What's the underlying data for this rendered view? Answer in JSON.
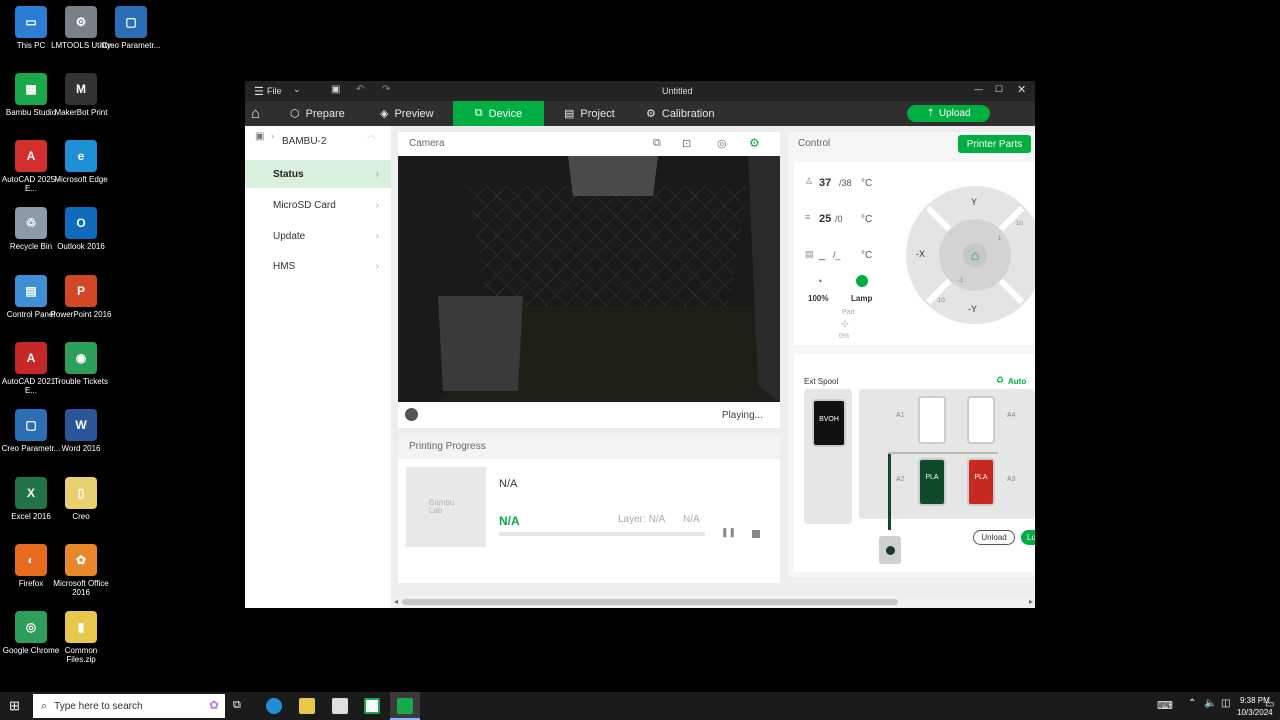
{
  "desktop_icons": [
    {
      "label": "This PC",
      "color": "#2a7fd4",
      "glyph": "▭"
    },
    {
      "label": "LMTOOLS Utility",
      "color": "#7a8088",
      "glyph": "⚙"
    },
    {
      "label": "Creo Parametr...",
      "color": "#2a6fb5",
      "glyph": "▢"
    },
    {
      "label": "Bambu Studio",
      "color": "#19a84a",
      "glyph": "▦"
    },
    {
      "label": "MakerBot Print",
      "color": "#333333",
      "glyph": "M"
    },
    {
      "label": "AutoCAD 2025 - E...",
      "color": "#d32f2f",
      "glyph": "A"
    },
    {
      "label": "Microsoft Edge",
      "color": "#1f8fd6",
      "glyph": "e"
    },
    {
      "label": "Recycle Bin",
      "color": "#8a9aa8",
      "glyph": "♲"
    },
    {
      "label": "Outlook 2016",
      "color": "#0f6cbd",
      "glyph": "O"
    },
    {
      "label": "Control Panel",
      "color": "#3d8fd6",
      "glyph": "▤"
    },
    {
      "label": "PowerPoint 2016",
      "color": "#d24726",
      "glyph": "P"
    },
    {
      "label": "AutoCAD 2021 - E...",
      "color": "#c62828",
      "glyph": "A"
    },
    {
      "label": "Trouble Tickets",
      "color": "#2e9e5b",
      "glyph": "◉"
    },
    {
      "label": "Creo Parametr...",
      "color": "#2a6fb5",
      "glyph": "▢"
    },
    {
      "label": "Word 2016",
      "color": "#2b579a",
      "glyph": "W"
    },
    {
      "label": "Excel 2016",
      "color": "#217346",
      "glyph": "X"
    },
    {
      "label": "Creo",
      "color": "#e8d070",
      "glyph": "▯"
    },
    {
      "label": "Firefox",
      "color": "#e86a1f",
      "glyph": "◐"
    },
    {
      "label": "Microsoft Office 2016",
      "color": "#e8862a",
      "glyph": "✿"
    },
    {
      "label": "Google Chrome",
      "color": "#2e9e5b",
      "glyph": "◎"
    },
    {
      "label": "Common Files.zip",
      "color": "#e8c84a",
      "glyph": "▮"
    }
  ],
  "window": {
    "title": "Untitled",
    "file_menu": "File"
  },
  "tabs": {
    "prepare": "Prepare",
    "preview": "Preview",
    "device": "Device",
    "project": "Project",
    "calibration": "Calibration",
    "upload": "Upload"
  },
  "sidebar": {
    "printer": "BAMBU-2",
    "items": [
      {
        "label": "Status"
      },
      {
        "label": "MicroSD Card"
      },
      {
        "label": "Update"
      },
      {
        "label": "HMS"
      }
    ]
  },
  "camera": {
    "title": "Camera",
    "status": "Playing..."
  },
  "progress": {
    "title": "Printing Progress",
    "name": "N/A",
    "status": "N/A",
    "layer": "Layer: N/A",
    "time": "N/A",
    "logo": "Bambu Lab"
  },
  "control": {
    "title": "Control",
    "printer_parts": "Printer Parts",
    "nozzle_temp": "37",
    "nozzle_target": "/38",
    "bed_temp": "25",
    "bed_target": "/0",
    "chamber_temp": "_",
    "chamber_target": "/_",
    "unit": "°C",
    "speed": "100%",
    "lamp": "Lamp",
    "part_label": "Part",
    "part_value": "0%",
    "jog": {
      "y_plus": "Y",
      "y_minus": "-Y",
      "x_minus": "-X",
      "step1": "1",
      "step10": "10",
      "step_neg1": "-1",
      "step_neg10": "-10"
    }
  },
  "ams": {
    "ext_spool": "Ext Spool",
    "auto": "Auto",
    "ext_material": "BVOH",
    "slots": [
      {
        "id": "A1",
        "material": ""
      },
      {
        "id": "A4",
        "material": ""
      },
      {
        "id": "A2",
        "material": "PLA"
      },
      {
        "id": "A3",
        "material": "PLA"
      }
    ],
    "unload": "Unload",
    "load": "Lo"
  },
  "taskbar": {
    "search": "Type here to search",
    "time": "9:38 PM",
    "date": "10/3/2024"
  },
  "colors": {
    "accent": "#00ae42",
    "titlebar": "#232323",
    "menubar": "#2f2f2f"
  }
}
